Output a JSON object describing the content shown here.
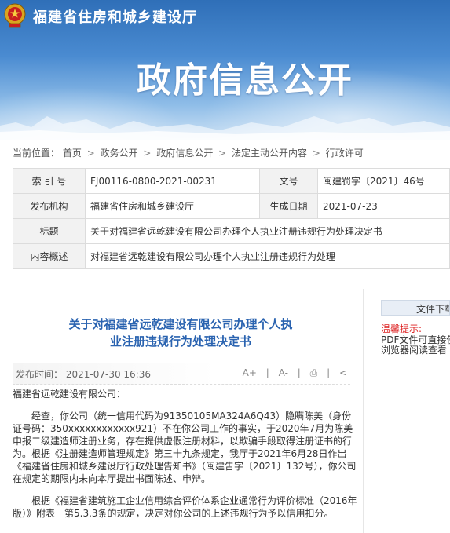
{
  "header": {
    "site_name": "福建省住房和城乡建设厅",
    "section_title": "政府信息公开"
  },
  "breadcrumb": {
    "prefix": "当前位置：",
    "items": [
      "首页",
      "政务公开",
      "政府信息公开",
      "法定主动公开内容",
      "行政许可"
    ],
    "separator": ">"
  },
  "meta": {
    "index_label": "索 引 号",
    "index_value": "FJ00116-0800-2021-00231",
    "docno_label": "文号",
    "docno_value": "闽建罚字〔2021〕46号",
    "issuer_label": "发布机构",
    "issuer_value": "福建省住房和城乡建设厅",
    "date_label": "生成日期",
    "date_value": "2021-07-23",
    "title_label": "标题",
    "title_value": "关于对福建省远乾建设有限公司办理个人执业注册违规行为处理决定书",
    "summary_label": "内容概述",
    "summary_value": "对福建省远乾建设有限公司办理个人执业注册违规行为处理"
  },
  "article": {
    "title_line1": "关于对福建省远乾建设有限公司办理个人执",
    "title_line2": "业注册违规行为处理决定书",
    "pub_label": "发布时间：",
    "pub_value": "2021-07-30 16:36",
    "font_up": "A+",
    "font_down": "A-",
    "print": "⎙",
    "share": "<",
    "salutation": "福建省远乾建设有限公司：",
    "para1": "经查，你公司（统一信用代码为91350105MA324A6Q43）隐瞒陈美（身份证号码：350xxxxxxxxxxxx921）不在你公司工作的事实，于2020年7月为陈美申报二级建造师注册业务，存在提供虚假注册材料，以欺骗手段取得注册证书的行为。根据《注册建造师管理规定》第三十九条规定，我厅于2021年6月28日作出《福建省住房和城乡建设厅行政处理告知书》（闽建吿字〔2021〕132号），你公司在规定的期限内未向本厅提出书面陈述、申辩。",
    "para2": "根据《福建省建筑施工企业信用综合评价体系企业通常行为评价标准（2016年版）》附表一第5.3.3条的规定，决定对你公司的上述违规行为予以信用扣分。"
  },
  "sidebar": {
    "download": "文件下载",
    "tip_label": "温馨提示:",
    "tip_line1": "PDF文件可直接使用",
    "tip_line2": "浏览器阅读查看"
  }
}
